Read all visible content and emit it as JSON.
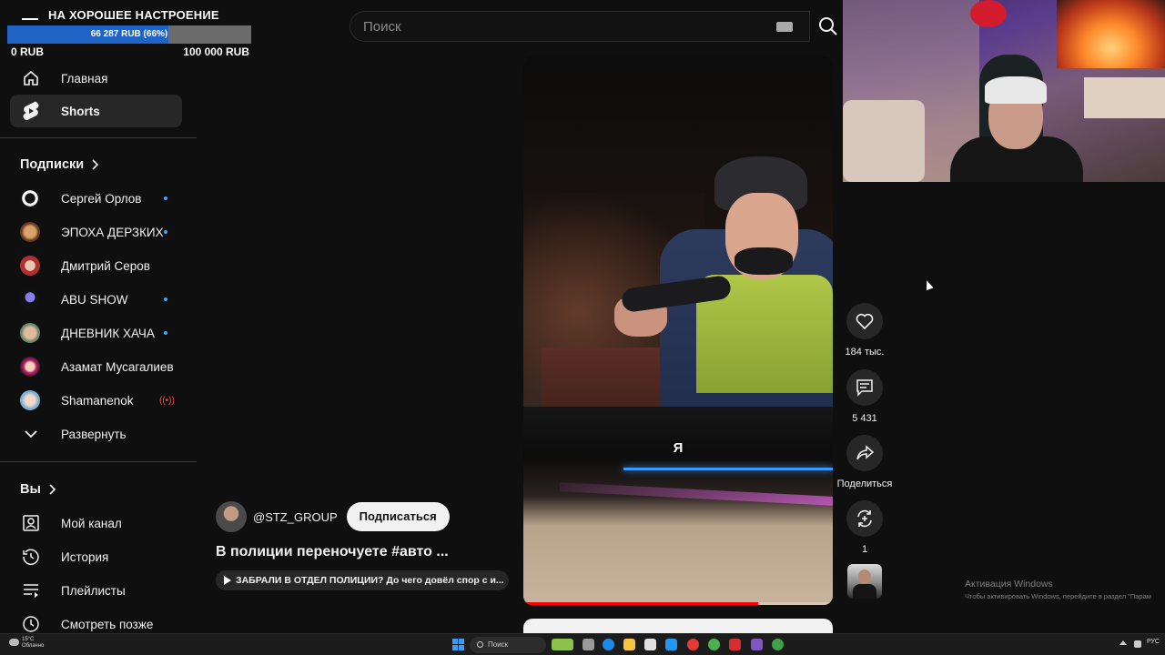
{
  "donation": {
    "title": "НА ХОРОШЕЕ НАСТРОЕНИЕ",
    "current_text": "66 287 RUB (66%)",
    "progress_fraction": 0.66,
    "min_label": "0 RUB",
    "max_label": "100 000 RUB"
  },
  "search": {
    "placeholder": "Поиск"
  },
  "sidebar": {
    "nav": [
      {
        "label": "Главная",
        "icon": "home-icon",
        "active": false
      },
      {
        "label": "Shorts",
        "icon": "shorts-icon",
        "active": true
      }
    ],
    "subscriptions_header": "Подписки",
    "subscriptions": [
      {
        "label": "Сергей Орлов",
        "indicator": "dot"
      },
      {
        "label": "ЭПОХА ДЕРЗКИХ",
        "indicator": "dot"
      },
      {
        "label": "Дмитрий Серов",
        "indicator": "none"
      },
      {
        "label": "ABU SHOW",
        "indicator": "dot"
      },
      {
        "label": "ДНЕВНИК ХАЧА",
        "indicator": "dot"
      },
      {
        "label": "Азамат Мусагалиев",
        "indicator": "none"
      },
      {
        "label": "Shamanenok",
        "indicator": "live"
      }
    ],
    "expand_label": "Развернуть",
    "you_header": "Вы",
    "you_items": [
      {
        "label": "Мой канал",
        "icon": "person-box-icon"
      },
      {
        "label": "История",
        "icon": "history-icon"
      },
      {
        "label": "Плейлисты",
        "icon": "playlists-icon"
      },
      {
        "label": "Смотреть позже",
        "icon": "clock-icon"
      }
    ]
  },
  "video": {
    "caption": "Я",
    "progress_fraction": 0.76,
    "channel_handle": "@STZ_GROUP",
    "subscribe_label": "Подписаться",
    "title": "В полиции переночуете #авто ...",
    "related_text": "ЗАБРАЛИ В ОТДЕЛ ПОЛИЦИИ? До чего довёл спор с и..."
  },
  "actions": {
    "likes": "184 тыс.",
    "comments": "5 431",
    "share_label": "Поделиться",
    "remix_count": "1"
  },
  "watermark": {
    "line1": "Активация Windows",
    "line2": "Чтобы активировать Windows, перейдите в раздел \"Парам"
  },
  "taskbar": {
    "weather_temp": "15°C",
    "weather_desc": "Облачно",
    "search_label": "Поиск",
    "lang": "РУС"
  },
  "colors": {
    "accent": "#3ea6ff",
    "progress_red": "#ff0000",
    "donation_fill": "#1f63c4"
  }
}
